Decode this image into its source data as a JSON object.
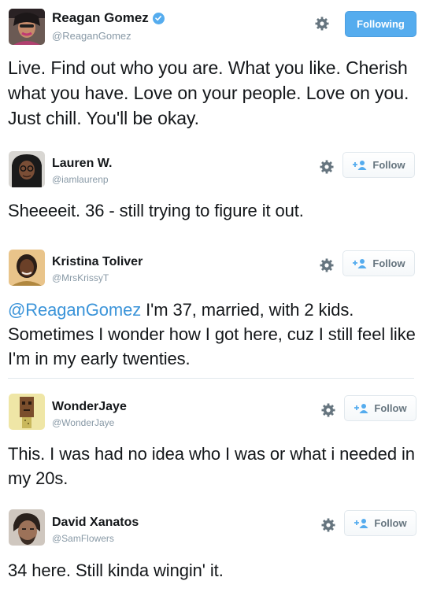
{
  "tweets": [
    {
      "name": "Reagan Gomez",
      "handle": "@ReaganGomez",
      "verified": true,
      "button": "Following",
      "text": "Live. Find out who you are. What you like. Cherish what you have. Love on your people. Love on you. Just chill. You'll be okay.",
      "mention": ""
    },
    {
      "name": "Lauren W.",
      "handle": "@iamlaurenp",
      "verified": false,
      "button": "Follow",
      "text": "Sheeeeit. 36 - still trying to figure it out.",
      "mention": ""
    },
    {
      "name": "Kristina Toliver",
      "handle": "@MrsKrissyT",
      "verified": false,
      "button": "Follow",
      "mention": "@ReaganGomez",
      "text": " I'm 37, married, with 2 kids. Sometimes I wonder how I got here, cuz I still feel like I'm in my early twenties."
    },
    {
      "name": "WonderJaye",
      "handle": "@WonderJaye",
      "verified": false,
      "button": "Follow",
      "text": "This. I was had no idea who I was or what i needed in my 20s.",
      "mention": ""
    },
    {
      "name": "David Xanatos",
      "handle": "@SamFlowers",
      "verified": false,
      "button": "Follow",
      "text": "34 here. Still kinda wingin' it.",
      "mention": ""
    }
  ],
  "colors": {
    "accent": "#55acee",
    "mention": "#3b94d9",
    "handle": "#8899a6",
    "follow_text": "#66757f"
  },
  "icons": {
    "gear": "gear-icon",
    "follow": "follow-person-plus-icon",
    "verified": "verified-badge-icon"
  }
}
